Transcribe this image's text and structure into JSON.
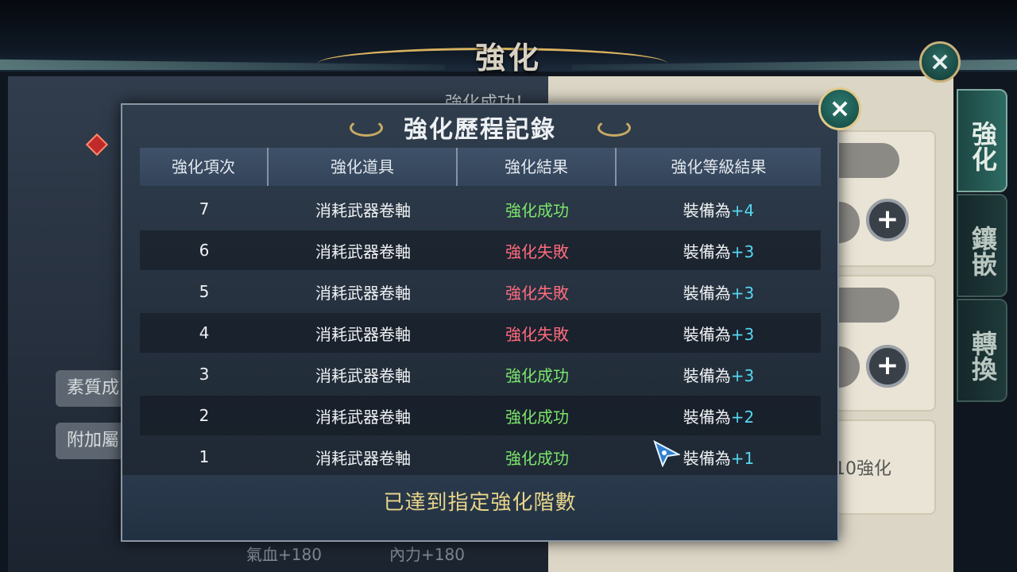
{
  "background": {
    "top_title": "強化",
    "success_text": "強化成功！",
    "left_buttons": [
      "素質成",
      "附加屬"
    ],
    "stats": [
      "氣血+180",
      "內力+180"
    ],
    "right_card_text": "10強化",
    "side_tabs": [
      "強化",
      "鑲嵌",
      "轉換"
    ]
  },
  "modal": {
    "title": "強化歷程記錄",
    "columns": [
      "強化項次",
      "強化道具",
      "強化結果",
      "強化等級結果"
    ],
    "rows": [
      {
        "index": "7",
        "item": "消耗武器卷軸",
        "result": "強化成功",
        "status": "success",
        "level_prefix": "裝備為",
        "level": "+4"
      },
      {
        "index": "6",
        "item": "消耗武器卷軸",
        "result": "強化失敗",
        "status": "fail",
        "level_prefix": "裝備為",
        "level": "+3"
      },
      {
        "index": "5",
        "item": "消耗武器卷軸",
        "result": "強化失敗",
        "status": "fail",
        "level_prefix": "裝備為",
        "level": "+3"
      },
      {
        "index": "4",
        "item": "消耗武器卷軸",
        "result": "強化失敗",
        "status": "fail",
        "level_prefix": "裝備為",
        "level": "+3"
      },
      {
        "index": "3",
        "item": "消耗武器卷軸",
        "result": "強化成功",
        "status": "success",
        "level_prefix": "裝備為",
        "level": "+3"
      },
      {
        "index": "2",
        "item": "消耗武器卷軸",
        "result": "強化成功",
        "status": "success",
        "level_prefix": "裝備為",
        "level": "+2"
      },
      {
        "index": "1",
        "item": "消耗武器卷軸",
        "result": "強化成功",
        "status": "success",
        "level_prefix": "裝備為",
        "level": "+1"
      }
    ],
    "footer": "已達到指定強化階數",
    "close_icon": "×"
  },
  "colors": {
    "success": "#7be56b",
    "fail": "#ff6b7d",
    "level": "#56d6f0",
    "footer": "#e8d48a"
  }
}
